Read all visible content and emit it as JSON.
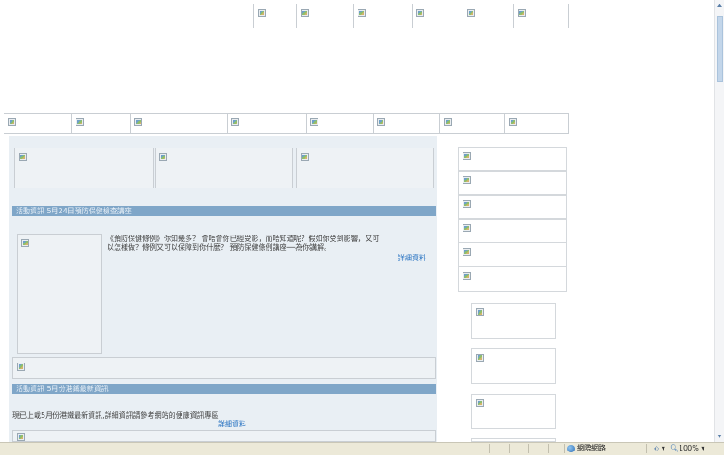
{
  "news_panel": {
    "section1_heading": "活動資訊 5月24日預防保健檢查講座",
    "article1_text_line1": "《預防保健條例》你知幾多？ 會唔會你已經受影，而唔知道呢？假如你受到影響，又可",
    "article1_text_line2": "以怎樣做？條例又可以保障到你什麼？ 預防保健條例講座──為你講解。",
    "article1_more_link": "詳細資料",
    "section2_heading": "活動資訊 5月份港鐵最新資訊",
    "article2_text": "現已上載5月份港鐵最新資訊,詳細資訊請參考網站的便康資訊專區",
    "article2_more_link": "詳細資料"
  },
  "status_bar": {
    "zone_label": "網際網路",
    "zoom": "100%"
  },
  "colors": {
    "heading_bar": "#7fa6c8",
    "panel_bg": "#e9eff4",
    "link": "#2a74c2"
  }
}
